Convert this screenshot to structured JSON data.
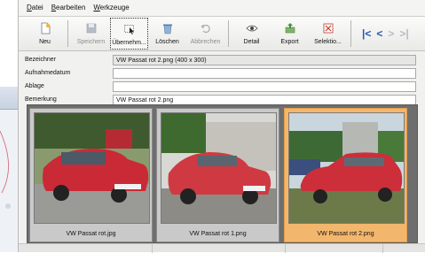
{
  "menu": {
    "items": [
      {
        "label": "Datei"
      },
      {
        "label": "Bearbeiten"
      },
      {
        "label": "Werkzeuge"
      }
    ]
  },
  "toolbar": {
    "new_label": "Neu",
    "save_label": "Speichern",
    "take_over_label": "Übernehm...",
    "delete_label": "Löschen",
    "cancel_label": "Abbrechen",
    "detail_label": "Detail",
    "export_label": "Export",
    "selection_label": "Selektio..."
  },
  "fields": {
    "designation": {
      "label": "Bezeichner",
      "value": "VW Passat rot 2.png (400 x 300)"
    },
    "shot_date": {
      "label": "Aufnahmedatum",
      "value": ""
    },
    "storage": {
      "label": "Ablage",
      "value": ""
    },
    "remark": {
      "label": "Bemerkung",
      "value": "VW Passat rot 2.png"
    }
  },
  "gallery": {
    "items": [
      {
        "caption": "VW Passat rot.jpg",
        "selected": false
      },
      {
        "caption": "VW Passat rot 1.png",
        "selected": false
      },
      {
        "caption": "VW Passat rot 2.png",
        "selected": true
      }
    ]
  },
  "colors": {
    "selection": "#f3b66d",
    "nav_active": "#2856b4",
    "car_red": "#c92a35"
  },
  "icons": {
    "new": "new-document-icon",
    "save": "floppy-disk-icon",
    "take_over": "cursor-select-icon",
    "delete": "recycle-bin-icon",
    "cancel": "undo-icon",
    "detail": "eye-icon",
    "export": "export-icon",
    "selection": "filter-selection-icon"
  }
}
